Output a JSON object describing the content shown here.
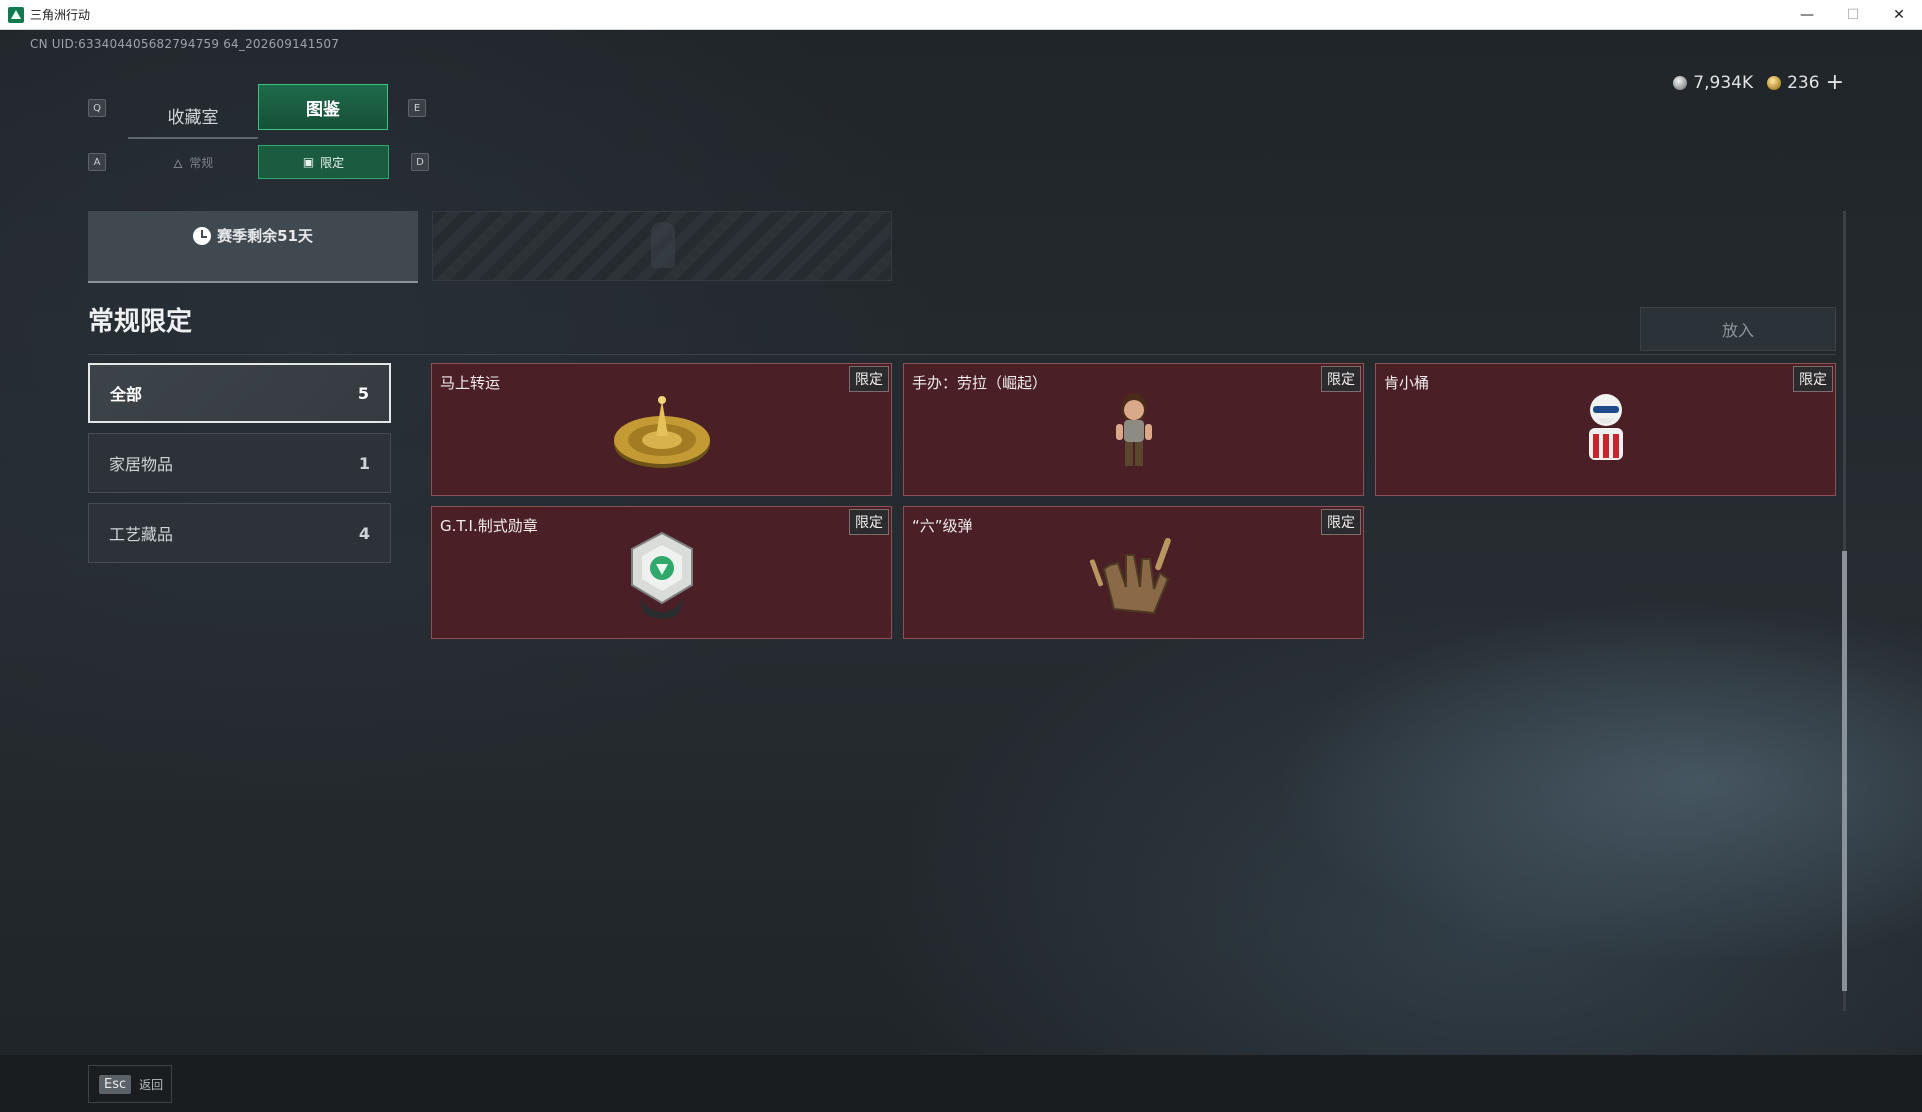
{
  "window": {
    "title": "三角洲行动",
    "minimize": "—",
    "maximize": "☐",
    "close": "✕"
  },
  "uid": "CN UID:633404405682794759 64_202609141507",
  "currency": {
    "silver": "7,934K",
    "gold": "236",
    "add": "+"
  },
  "keys": {
    "prev_tab": "Q",
    "next_tab": "E",
    "prev_subtab": "A",
    "next_subtab": "D"
  },
  "tabs": [
    {
      "label": "收藏室",
      "active": false
    },
    {
      "label": "图鉴",
      "active": true
    }
  ],
  "subtabs": [
    {
      "label": "常规",
      "active": false
    },
    {
      "label": "限定",
      "active": true
    }
  ],
  "season": {
    "remaining": "赛季剩余51天"
  },
  "section_title": "常规限定",
  "put_button": "放入",
  "categories": [
    {
      "label": "全部",
      "count": "5",
      "active": true
    },
    {
      "label": "家居物品",
      "count": "1",
      "active": false
    },
    {
      "label": "工艺藏品",
      "count": "4",
      "active": false
    }
  ],
  "items": [
    {
      "name": "马上转运",
      "badge": "限定",
      "icon": "compass-disc-icon"
    },
    {
      "name": "手办：劳拉（崛起）",
      "badge": "限定",
      "icon": "figurine-icon"
    },
    {
      "name": "肯小桶",
      "badge": "限定",
      "icon": "mascot-icon"
    },
    {
      "name": "G.T.I.制式勋章",
      "badge": "限定",
      "icon": "medal-icon"
    },
    {
      "name": "“六”级弹",
      "badge": "限定",
      "icon": "bullet-hand-icon"
    }
  ],
  "bottom": {
    "esc_key": "Esc",
    "esc_label": "返回"
  },
  "colors": {
    "accent": "#39c486",
    "card_bg": "#4a1f25",
    "card_border": "#8a5257"
  }
}
